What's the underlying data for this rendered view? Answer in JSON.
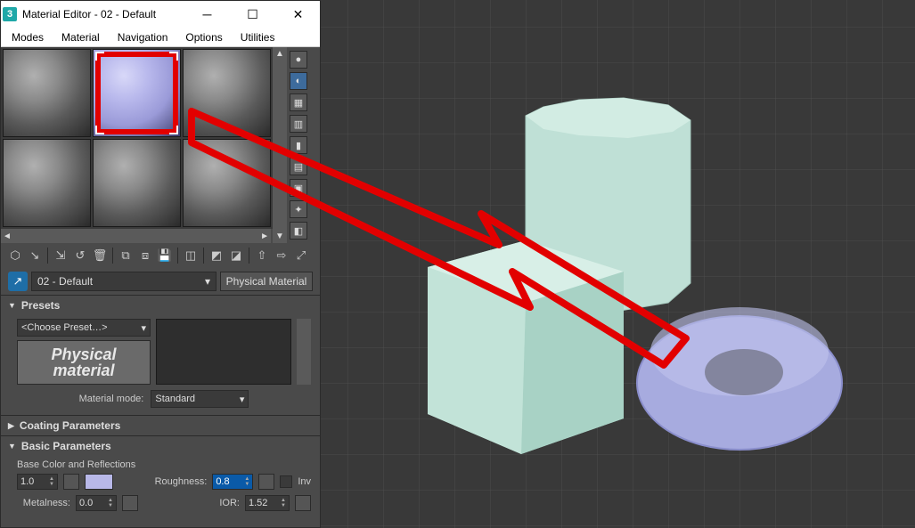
{
  "window": {
    "title": "Material Editor - 02 - Default"
  },
  "menu": {
    "modes": "Modes",
    "material": "Material",
    "navigation": "Navigation",
    "options": "Options",
    "utilities": "Utilities"
  },
  "samples": {
    "selected_index": 1,
    "count": 6
  },
  "side_tools": {
    "sample_type": "●",
    "backlight": "◐",
    "background": "▦",
    "uv_tiling": "▥",
    "colorchips": "▮",
    "video_check": "▤",
    "make_preview": "▣",
    "options2": "✦",
    "select_by": "◧"
  },
  "toolbar": {
    "get_material": "⬡",
    "put_to_scene": "↘",
    "assign_to_sel": "⇲",
    "reset": "↺",
    "delete": "🗑",
    "make_copy": "⧉",
    "make_unique": "⧈",
    "put_to_lib": "💾",
    "mat_map_nav": "◫",
    "back_sibling": "◩",
    "fwd_sibling": "◪",
    "go_parent": "⇧",
    "go_forward": "⇨",
    "pick_from_obj": "⤢"
  },
  "namerow": {
    "material_name": "02 - Default",
    "material_type": "Physical Material"
  },
  "presets": {
    "title": "Presets",
    "dropdown": "<Choose Preset…>",
    "logo_line1": "Physical",
    "logo_line2": "material",
    "mode_label": "Material mode:",
    "mode_value": "Standard"
  },
  "coating": {
    "title": "Coating Parameters"
  },
  "basic": {
    "title": "Basic Parameters",
    "section": "Base Color and Reflections",
    "weight_label": "",
    "weight_value": "1.0",
    "metalness_label": "Metalness:",
    "metalness_value": "0.0",
    "roughness_label": "Roughness:",
    "roughness_value": "0.8",
    "inv_label": "Inv",
    "ior_label": "IOR:",
    "ior_value": "1.52"
  }
}
